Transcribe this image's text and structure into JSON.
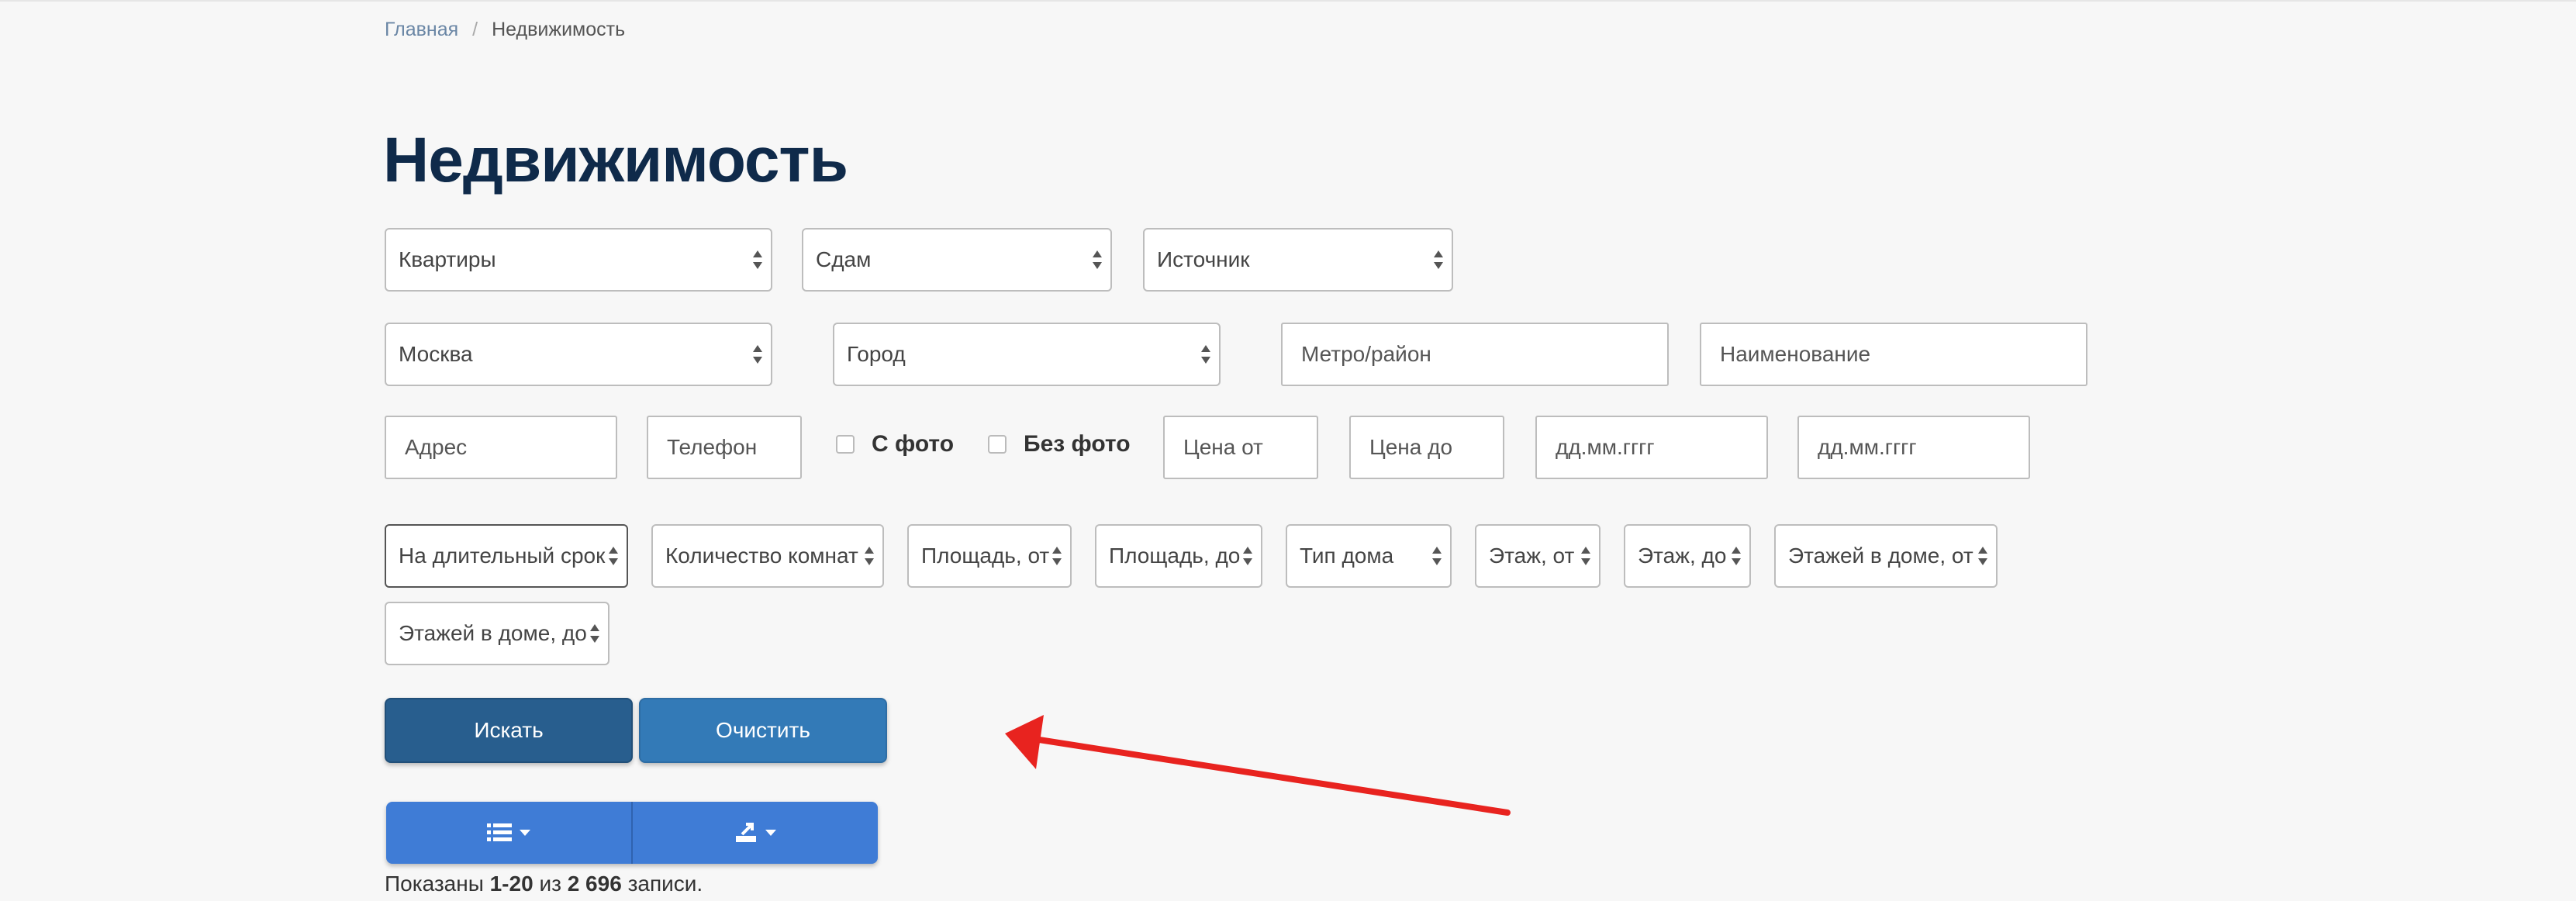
{
  "breadcrumb": {
    "home": "Главная",
    "separator": "/",
    "current": "Недвижимость"
  },
  "page_title": "Недвижимость",
  "filters": {
    "property_type": "Квартиры",
    "deal_type": "Сдам",
    "source": "Источник",
    "region": "Москва",
    "city": "Город",
    "metro_placeholder": "Метро/район",
    "name_placeholder": "Наименование",
    "address_placeholder": "Адрес",
    "phone_placeholder": "Телефон",
    "with_photo_label": "С фото",
    "without_photo_label": "Без фото",
    "price_from_placeholder": "Цена от",
    "price_to_placeholder": "Цена до",
    "date_from_placeholder": "дд.мм.гггг",
    "date_to_placeholder": "дд.мм.гггг",
    "term": "На длительный срок",
    "rooms": "Количество комнат",
    "area_from": "Площадь, от",
    "area_to": "Площадь, до",
    "house_type": "Тип дома",
    "floor_from": "Этаж, от",
    "floor_to": "Этаж, до",
    "floors_from": "Этажей в доме, от",
    "floors_to": "Этажей в доме, до"
  },
  "actions": {
    "search_label": "Искать",
    "clear_label": "Очистить"
  },
  "toolbar": {
    "list_icon": "list-icon",
    "export_icon": "export-icon"
  },
  "summary": {
    "prefix": "Показаны",
    "range": "1-20",
    "of": "из",
    "total": "2 696",
    "suffix": "записи."
  },
  "colors": {
    "title": "#0f2a4a",
    "search_button": "#285e8e",
    "clear_button": "#337ab7",
    "toolbar": "#3f7cd6",
    "annotation_arrow": "#e8231f"
  }
}
